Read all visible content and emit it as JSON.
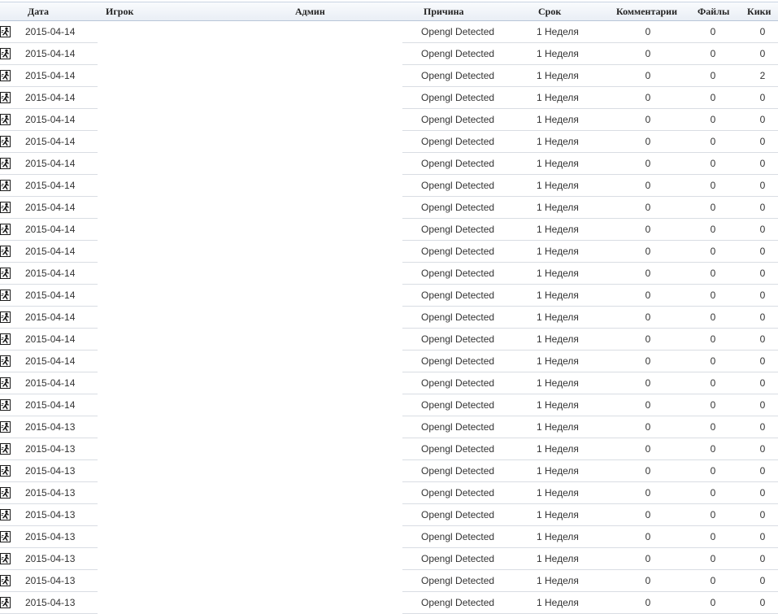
{
  "table": {
    "columns": [
      {
        "key": "date",
        "label": "Дата"
      },
      {
        "key": "player",
        "label": "Игрок"
      },
      {
        "key": "admin",
        "label": "Админ"
      },
      {
        "key": "reason",
        "label": "Причина"
      },
      {
        "key": "term",
        "label": "Срок"
      },
      {
        "key": "comments",
        "label": "Комментарии"
      },
      {
        "key": "files",
        "label": "Файлы"
      },
      {
        "key": "kicks",
        "label": "Кики"
      }
    ],
    "row_icon": "running-man-icon",
    "rows": [
      {
        "date": "2015-04-14",
        "player": "",
        "admin": "",
        "reason": "Opengl Detected",
        "term": "1 Неделя",
        "comments": "0",
        "files": "0",
        "kicks": "0"
      },
      {
        "date": "2015-04-14",
        "player": "",
        "admin": "",
        "reason": "Opengl Detected",
        "term": "1 Неделя",
        "comments": "0",
        "files": "0",
        "kicks": "0"
      },
      {
        "date": "2015-04-14",
        "player": "",
        "admin": "",
        "reason": "Opengl Detected",
        "term": "1 Неделя",
        "comments": "0",
        "files": "0",
        "kicks": "2"
      },
      {
        "date": "2015-04-14",
        "player": "",
        "admin": "",
        "reason": "Opengl Detected",
        "term": "1 Неделя",
        "comments": "0",
        "files": "0",
        "kicks": "0"
      },
      {
        "date": "2015-04-14",
        "player": "",
        "admin": "",
        "reason": "Opengl Detected",
        "term": "1 Неделя",
        "comments": "0",
        "files": "0",
        "kicks": "0"
      },
      {
        "date": "2015-04-14",
        "player": "",
        "admin": "",
        "reason": "Opengl Detected",
        "term": "1 Неделя",
        "comments": "0",
        "files": "0",
        "kicks": "0"
      },
      {
        "date": "2015-04-14",
        "player": "",
        "admin": "",
        "reason": "Opengl Detected",
        "term": "1 Неделя",
        "comments": "0",
        "files": "0",
        "kicks": "0"
      },
      {
        "date": "2015-04-14",
        "player": "",
        "admin": "",
        "reason": "Opengl Detected",
        "term": "1 Неделя",
        "comments": "0",
        "files": "0",
        "kicks": "0"
      },
      {
        "date": "2015-04-14",
        "player": "",
        "admin": "",
        "reason": "Opengl Detected",
        "term": "1 Неделя",
        "comments": "0",
        "files": "0",
        "kicks": "0"
      },
      {
        "date": "2015-04-14",
        "player": "",
        "admin": "",
        "reason": "Opengl Detected",
        "term": "1 Неделя",
        "comments": "0",
        "files": "0",
        "kicks": "0"
      },
      {
        "date": "2015-04-14",
        "player": "",
        "admin": "",
        "reason": "Opengl Detected",
        "term": "1 Неделя",
        "comments": "0",
        "files": "0",
        "kicks": "0"
      },
      {
        "date": "2015-04-14",
        "player": "",
        "admin": "",
        "reason": "Opengl Detected",
        "term": "1 Неделя",
        "comments": "0",
        "files": "0",
        "kicks": "0"
      },
      {
        "date": "2015-04-14",
        "player": "",
        "admin": "",
        "reason": "Opengl Detected",
        "term": "1 Неделя",
        "comments": "0",
        "files": "0",
        "kicks": "0"
      },
      {
        "date": "2015-04-14",
        "player": "",
        "admin": "",
        "reason": "Opengl Detected",
        "term": "1 Неделя",
        "comments": "0",
        "files": "0",
        "kicks": "0"
      },
      {
        "date": "2015-04-14",
        "player": "",
        "admin": "",
        "reason": "Opengl Detected",
        "term": "1 Неделя",
        "comments": "0",
        "files": "0",
        "kicks": "0"
      },
      {
        "date": "2015-04-14",
        "player": "",
        "admin": "",
        "reason": "Opengl Detected",
        "term": "1 Неделя",
        "comments": "0",
        "files": "0",
        "kicks": "0"
      },
      {
        "date": "2015-04-14",
        "player": "",
        "admin": "",
        "reason": "Opengl Detected",
        "term": "1 Неделя",
        "comments": "0",
        "files": "0",
        "kicks": "0"
      },
      {
        "date": "2015-04-14",
        "player": "",
        "admin": "",
        "reason": "Opengl Detected",
        "term": "1 Неделя",
        "comments": "0",
        "files": "0",
        "kicks": "0"
      },
      {
        "date": "2015-04-13",
        "player": "",
        "admin": "",
        "reason": "Opengl Detected",
        "term": "1 Неделя",
        "comments": "0",
        "files": "0",
        "kicks": "0"
      },
      {
        "date": "2015-04-13",
        "player": "",
        "admin": "",
        "reason": "Opengl Detected",
        "term": "1 Неделя",
        "comments": "0",
        "files": "0",
        "kicks": "0"
      },
      {
        "date": "2015-04-13",
        "player": "",
        "admin": "",
        "reason": "Opengl Detected",
        "term": "1 Неделя",
        "comments": "0",
        "files": "0",
        "kicks": "0"
      },
      {
        "date": "2015-04-13",
        "player": "",
        "admin": "",
        "reason": "Opengl Detected",
        "term": "1 Неделя",
        "comments": "0",
        "files": "0",
        "kicks": "0"
      },
      {
        "date": "2015-04-13",
        "player": "",
        "admin": "",
        "reason": "Opengl Detected",
        "term": "1 Неделя",
        "comments": "0",
        "files": "0",
        "kicks": "0"
      },
      {
        "date": "2015-04-13",
        "player": "",
        "admin": "",
        "reason": "Opengl Detected",
        "term": "1 Неделя",
        "comments": "0",
        "files": "0",
        "kicks": "0"
      },
      {
        "date": "2015-04-13",
        "player": "",
        "admin": "",
        "reason": "Opengl Detected",
        "term": "1 Неделя",
        "comments": "0",
        "files": "0",
        "kicks": "0"
      },
      {
        "date": "2015-04-13",
        "player": "",
        "admin": "",
        "reason": "Opengl Detected",
        "term": "1 Неделя",
        "comments": "0",
        "files": "0",
        "kicks": "0"
      },
      {
        "date": "2015-04-13",
        "player": "",
        "admin": "",
        "reason": "Opengl Detected",
        "term": "1 Неделя",
        "comments": "0",
        "files": "0",
        "kicks": "0"
      }
    ]
  }
}
